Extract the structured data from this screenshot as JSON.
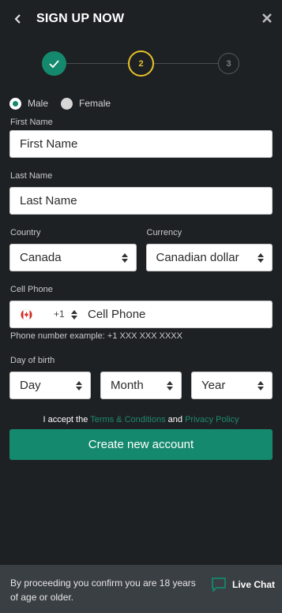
{
  "header": {
    "title": "SIGN UP NOW",
    "back_icon": "chevron-left-icon",
    "close_icon": "close-icon"
  },
  "stepper": {
    "steps": [
      {
        "label": "",
        "state": "done",
        "icon": "checkmark-icon"
      },
      {
        "label": "2",
        "state": "current"
      },
      {
        "label": "3",
        "state": "upcoming"
      }
    ],
    "colors": {
      "done": "#15896d",
      "current": "#e6c229",
      "upcoming": "#555a5e"
    }
  },
  "gender": {
    "options": [
      {
        "label": "Male",
        "selected": true
      },
      {
        "label": "Female",
        "selected": false
      }
    ]
  },
  "form": {
    "first_name": {
      "label": "First Name",
      "placeholder": "First Name"
    },
    "last_name": {
      "label": "Last Name",
      "placeholder": "Last Name"
    },
    "country": {
      "label": "Country",
      "value": "Canada"
    },
    "currency": {
      "label": "Currency",
      "value": "Canadian dollar"
    },
    "cell_phone": {
      "label": "Cell Phone",
      "flag_icon": "canada-flag-icon",
      "dial_code": "+1",
      "placeholder": "Cell Phone",
      "hint": "Phone number example: +1 XXX XXX XXXX"
    },
    "dob": {
      "label": "Day of birth",
      "day": "Day",
      "month": "Month",
      "year": "Year"
    }
  },
  "terms": {
    "prefix": "I accept the",
    "terms_link": "Terms & Conditions",
    "and": "and",
    "privacy_link": "Privacy Policy"
  },
  "submit_label": "Create new account",
  "footer": {
    "notice": "By proceeding you confirm you are 18 years of age or older.",
    "live_chat_label": "Live Chat",
    "chat_icon": "chat-bubble-icon"
  },
  "colors": {
    "background": "#1e2124",
    "accent": "#15896d",
    "footer": "#3a3f44"
  }
}
